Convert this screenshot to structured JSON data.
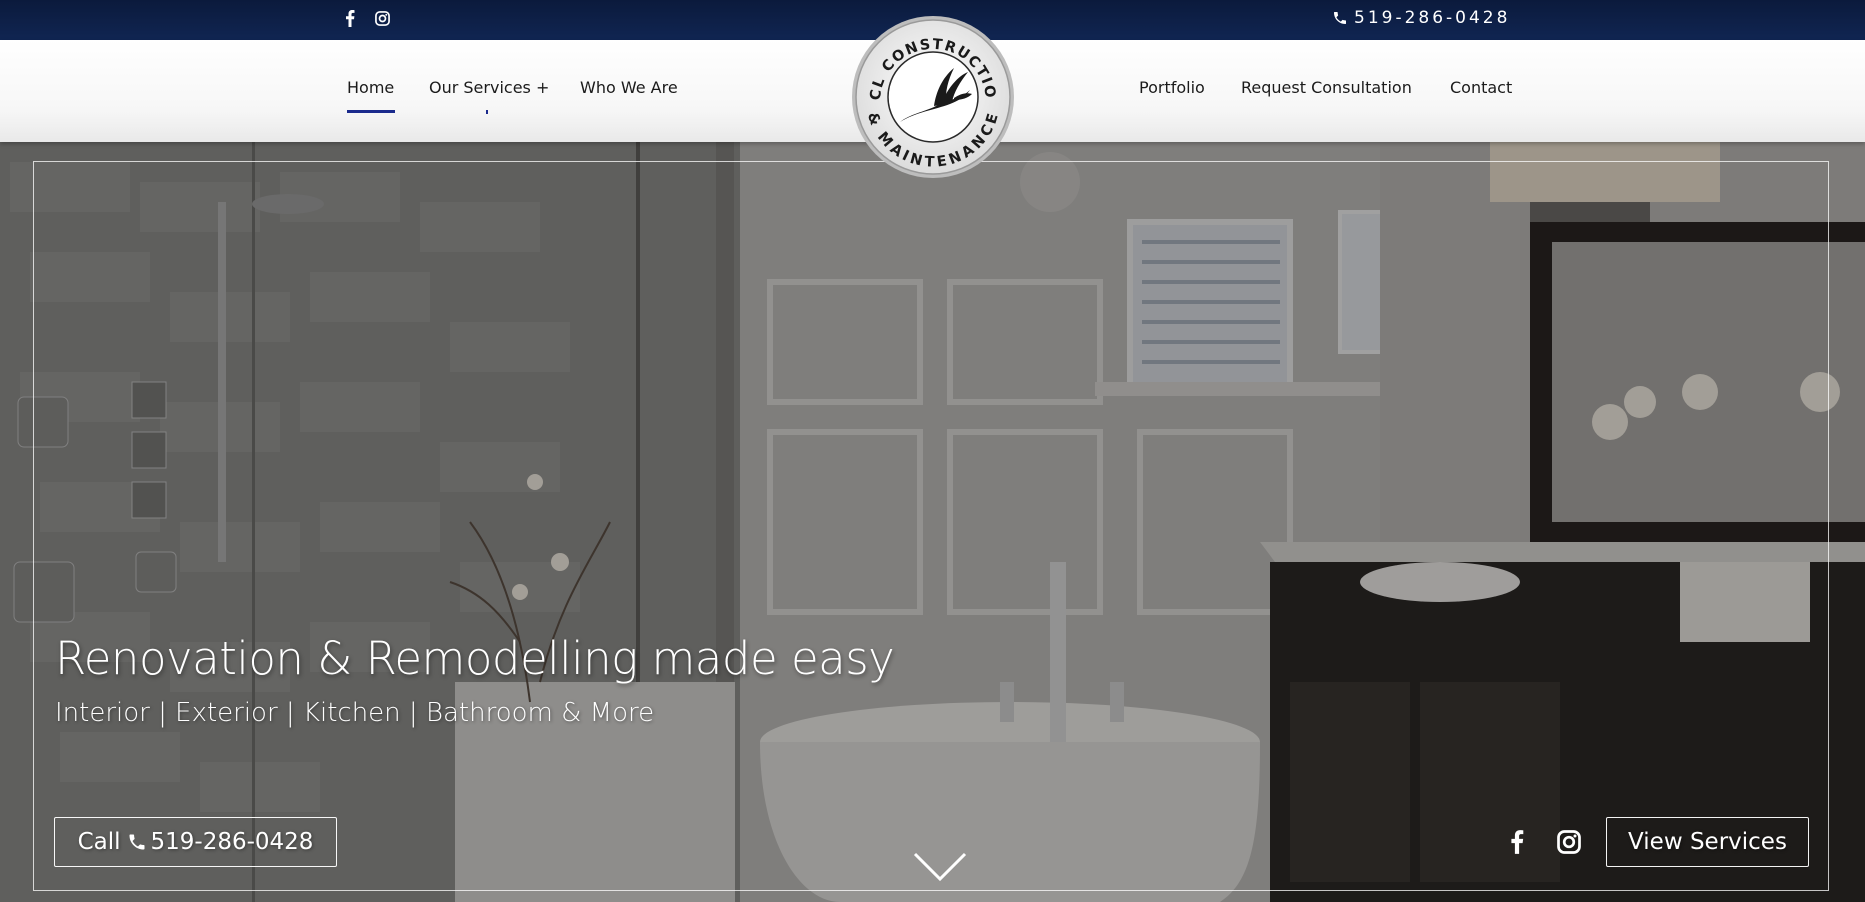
{
  "topbar": {
    "social_icons": [
      "facebook-icon",
      "instagram-icon"
    ],
    "phone_icon": "phone-icon",
    "phone": "519-286-0428"
  },
  "nav": {
    "left": [
      "Home",
      "Our Services +",
      "Who We Are"
    ],
    "right": [
      "Portfolio",
      "Request Consultation",
      "Contact"
    ],
    "active": "Home",
    "accent": "#1a2a8c"
  },
  "logo": {
    "text_top": "ACL CONSTRUCTION",
    "text_bottom": "& MAINTENANCE",
    "emblem": "bird-emblem"
  },
  "hero": {
    "title": "Renovation & Remodelling made easy",
    "subtitle": "Interior | Exterior | Kitchen | Bathroom & More",
    "call_label": "Call",
    "call_phone": "519-286-0428",
    "view_services": "View Services",
    "social_icons": [
      "facebook-icon",
      "instagram-icon"
    ],
    "scroll_icon": "chevron-down-icon",
    "background": "bathroom-interior-photo"
  },
  "colors": {
    "topbar": "#0b1a3c",
    "accent": "#1a2a8c",
    "nav_text": "#1b1b1b"
  }
}
